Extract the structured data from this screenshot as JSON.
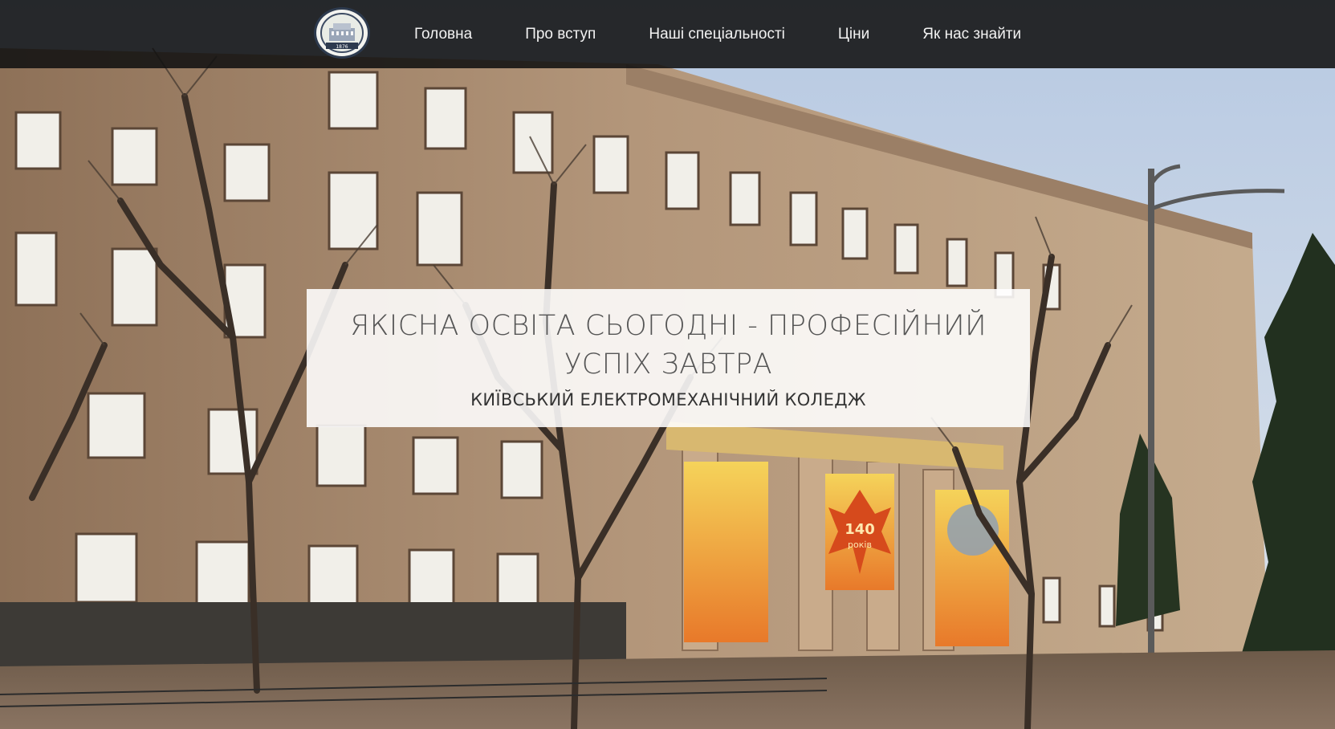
{
  "nav": {
    "logo_year": "1876",
    "items": [
      {
        "label": "Головна"
      },
      {
        "label": "Про вступ"
      },
      {
        "label": "Наші спеціальності"
      },
      {
        "label": "Ціни"
      },
      {
        "label": "Як нас знайти"
      }
    ]
  },
  "hero": {
    "headline": "ЯКІСНА ОСВІТА СЬОГОДНІ - ПРОФЕСІЙНИЙ УСПІХ ЗАВТРА",
    "subheadline": "КИЇВСЬКИЙ ЕЛЕКТРОМЕХАНІЧНИЙ КОЛЕДЖ",
    "banner_number": "140",
    "banner_word": "років"
  },
  "colors": {
    "navbar": "#111111",
    "card": "#ffffff",
    "headline": "#555555",
    "subline": "#333333",
    "building": "#a8876a",
    "sky": "#c9d6e8"
  }
}
